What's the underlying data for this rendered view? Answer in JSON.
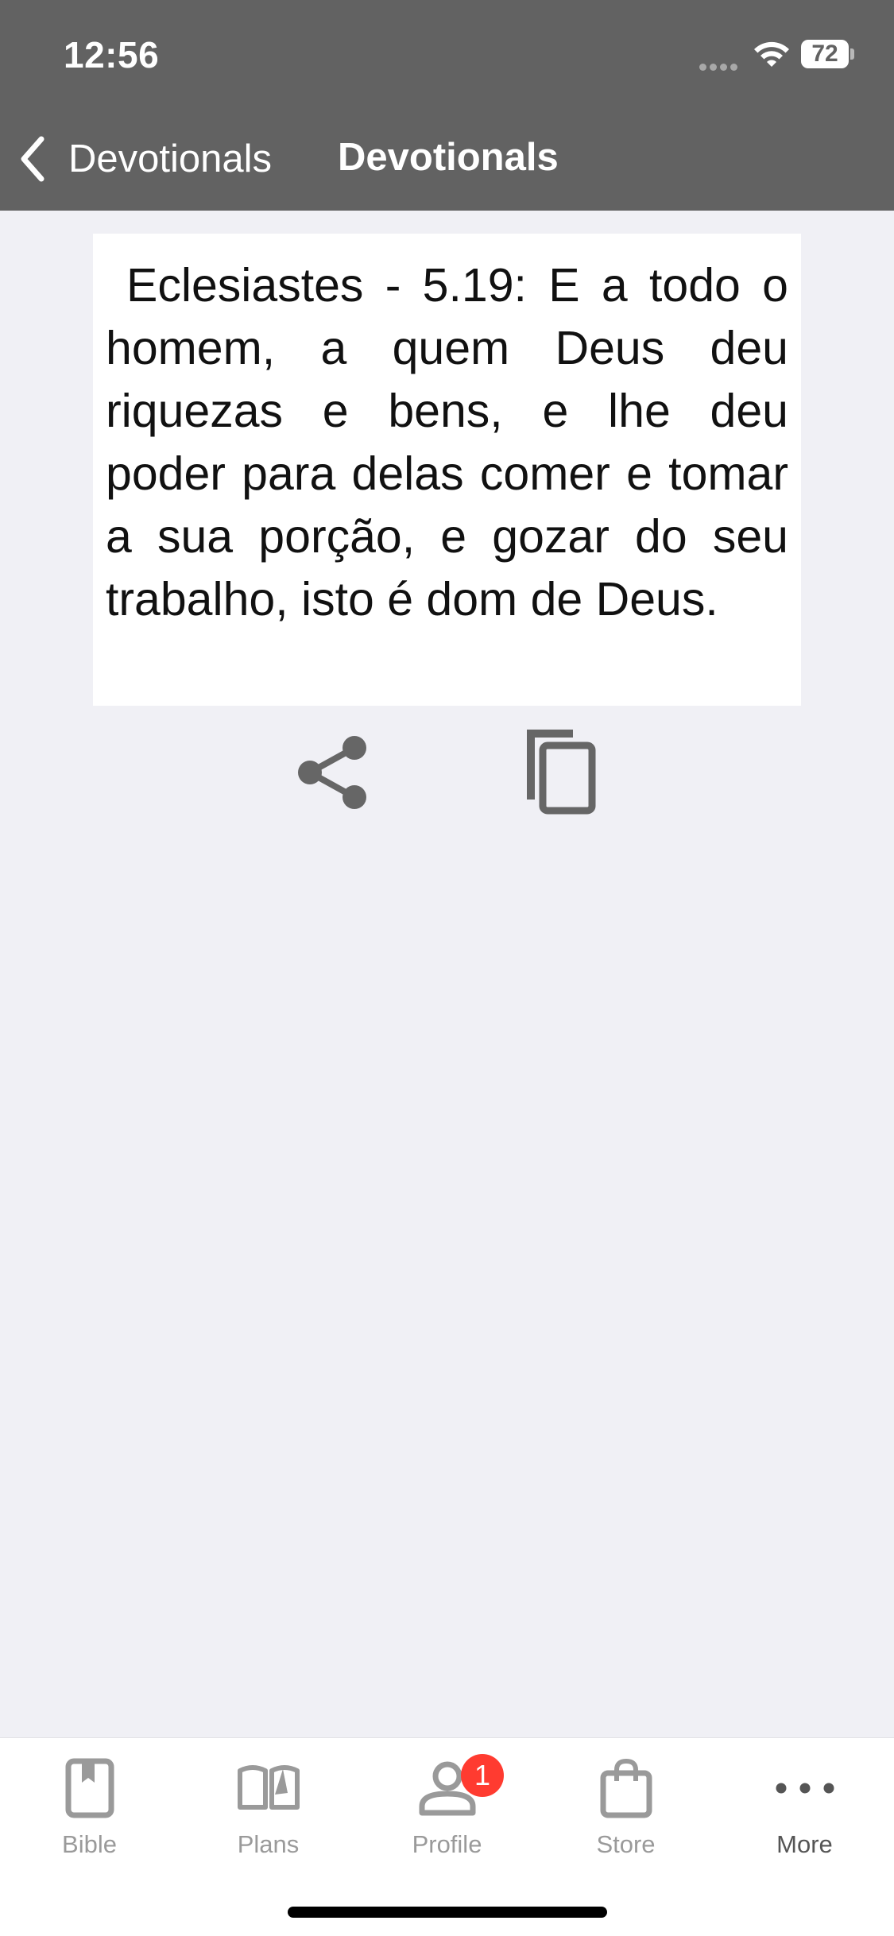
{
  "status_bar": {
    "time": "12:56",
    "battery": "72"
  },
  "nav": {
    "back_label": "Devotionals",
    "title": "Devotionals"
  },
  "verse": {
    "text": "Eclesiastes - 5.19: E a todo o homem, a quem Deus deu riquezas e bens, e lhe deu poder para delas comer e tomar a sua porção, e gozar do seu trabalho, isto é dom de Deus."
  },
  "actions": {
    "share_icon": "share-icon",
    "copy_icon": "copy-icon"
  },
  "tabs": [
    {
      "label": "Bible",
      "icon": "bible-icon"
    },
    {
      "label": "Plans",
      "icon": "book-open-icon"
    },
    {
      "label": "Profile",
      "icon": "person-icon",
      "badge": "1"
    },
    {
      "label": "Store",
      "icon": "shopping-bag-icon"
    },
    {
      "label": "More",
      "icon": "more-icon"
    }
  ],
  "colors": {
    "header": "#626262",
    "background": "#f0f0f5",
    "badge": "#ff3b30",
    "icon": "#666666",
    "tab_inactive": "#9a9a9a"
  }
}
